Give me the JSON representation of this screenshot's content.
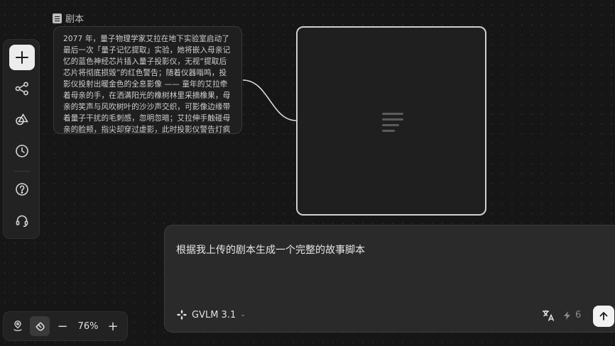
{
  "toolbar": {
    "items": [
      {
        "name": "add",
        "icon": "plus-icon"
      },
      {
        "name": "workflow",
        "icon": "node-graph-icon"
      },
      {
        "name": "assets",
        "icon": "shapes-icon"
      },
      {
        "name": "history",
        "icon": "clock-icon"
      },
      {
        "name": "help",
        "icon": "question-icon"
      },
      {
        "name": "support",
        "icon": "headset-icon"
      }
    ]
  },
  "script_node": {
    "label": "剧本",
    "icon": "document-icon",
    "content": "2077 年，量子物理学家艾拉在地下实验室启动了最后一次「量子记忆提取」实验，她将嵌入母亲记忆的蓝色神经芯片插入量子投影仪，无视“提取后芯片将彻底损毁”的红色警告；随着仪器嗡鸣，投影仪投射出暖金色的全息影像 —— 童年的艾拉牵着母亲的手，在洒满阳光的橡树林里采摘橡果，母亲的笑声与风吹树叶的沙沙声交织，可影像边缘带着量子干扰的毛刺感，忽明忽暗；艾拉伸手触碰母亲的脸颊，指尖却穿过虚影，此时投影仪警告灯疯"
  },
  "text_node": {
    "icon": "text-lines-icon"
  },
  "prompt": {
    "text": "根据我上传的剧本生成一个完整的故事脚本",
    "model_name": "GVLM 3.1",
    "credits": "6"
  },
  "zoom": {
    "level": "76%",
    "minus": "−",
    "plus": "+"
  },
  "colors": {
    "background": "#161616",
    "panel": "#222222",
    "selected_border": "#cfcfcf",
    "accent_button": "#f2f2f2"
  }
}
